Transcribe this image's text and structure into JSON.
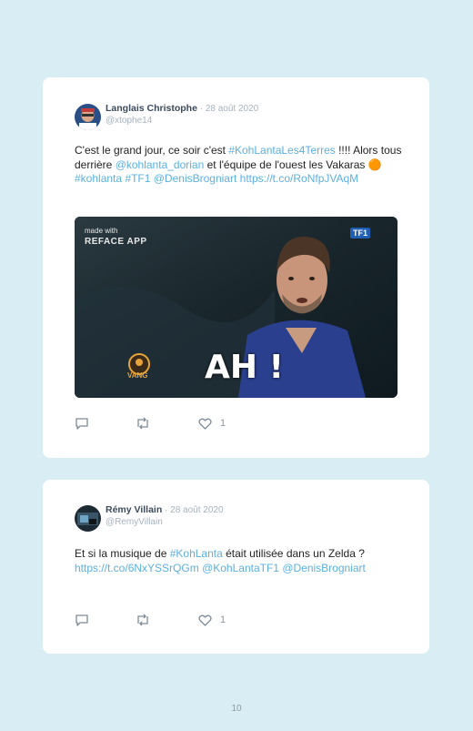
{
  "tweets": [
    {
      "author": "Langlais Christophe",
      "separator": " · ",
      "date": "28 août 2020",
      "handle": "@xtophe14",
      "text": {
        "p1": "C'est le grand jour, ce soir c'est ",
        "tag1": "#KohLantaLes4Terres",
        "p2": " !!!! Alors tous derrière ",
        "mention1": "@kohlanta_dorian",
        "p3": " et l'équipe de l'ouest les Vakaras ",
        "emoji": "🟠",
        "p4": " ",
        "tag2": "#kohlanta",
        "p5": " ",
        "tag3": "#TF1",
        "p6": " ",
        "mention2": "@DenisBrogniart",
        "p7": " ",
        "link": "https://t.co/RoNfpJVAqM"
      },
      "media": {
        "made_with": "made with",
        "app": "REFACE APP",
        "channel": "TF1",
        "caption": "AH !",
        "logo_text": "VANG"
      },
      "likes": "1"
    },
    {
      "author": "Rémy Villain",
      "separator": " · ",
      "date": "28 août 2020",
      "handle": "@RemyVillain",
      "text": {
        "p1": "Et si la musique de ",
        "tag1": "#KohLanta",
        "p2": " était utilisée dans un Zelda ? ",
        "link": "https://t.co/6NxYSSrQGm",
        "p3": " ",
        "mention1": "@KohLantaTF1",
        "p4": " ",
        "mention2": "@DenisBrogniart"
      },
      "likes": "1"
    }
  ],
  "page_number": "10",
  "colors": {
    "background": "#d8eef4",
    "link": "#5cb0e0",
    "author": "#3b4a5c"
  },
  "icons": [
    "reply-icon",
    "retweet-icon",
    "like-icon"
  ]
}
